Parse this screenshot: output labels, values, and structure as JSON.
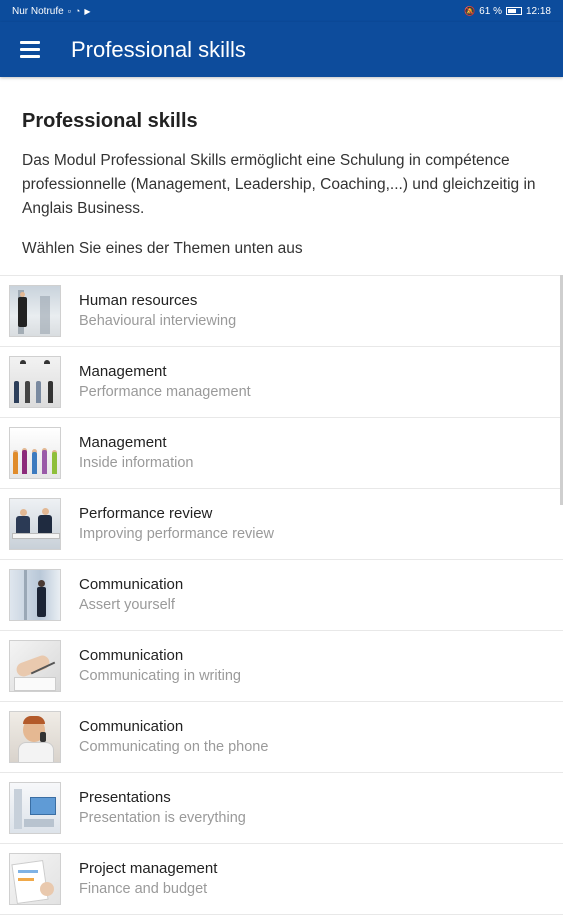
{
  "status_bar": {
    "carrier": "Nur Notrufe",
    "battery": "61 %",
    "time": "12:18"
  },
  "app_bar": {
    "menu_icon": "hamburger-menu-icon",
    "title": "Professional skills"
  },
  "page": {
    "heading": "Professional skills",
    "intro": "Das Modul Professional Skills ermöglicht eine Schulung in compétence professionnelle (Management, Leadership, Coaching,...) und gleichzeitig in Anglais Business.",
    "prompt": "Wählen Sie eines der Themen unten aus"
  },
  "topics": [
    {
      "title": "Human resources",
      "subtitle": "Behavioural interviewing"
    },
    {
      "title": "Management",
      "subtitle": "Performance management"
    },
    {
      "title": "Management",
      "subtitle": "Inside information"
    },
    {
      "title": "Performance review",
      "subtitle": "Improving performance review"
    },
    {
      "title": "Communication",
      "subtitle": "Assert yourself"
    },
    {
      "title": "Communication",
      "subtitle": "Communicating in writing"
    },
    {
      "title": "Communication",
      "subtitle": "Communicating on the phone"
    },
    {
      "title": "Presentations",
      "subtitle": "Presentation is everything"
    },
    {
      "title": "Project management",
      "subtitle": "Finance and budget"
    }
  ],
  "colors": {
    "app_bar": "#0d4c9c",
    "title_text": "#222222",
    "subtitle_text": "#9a9a9a"
  }
}
